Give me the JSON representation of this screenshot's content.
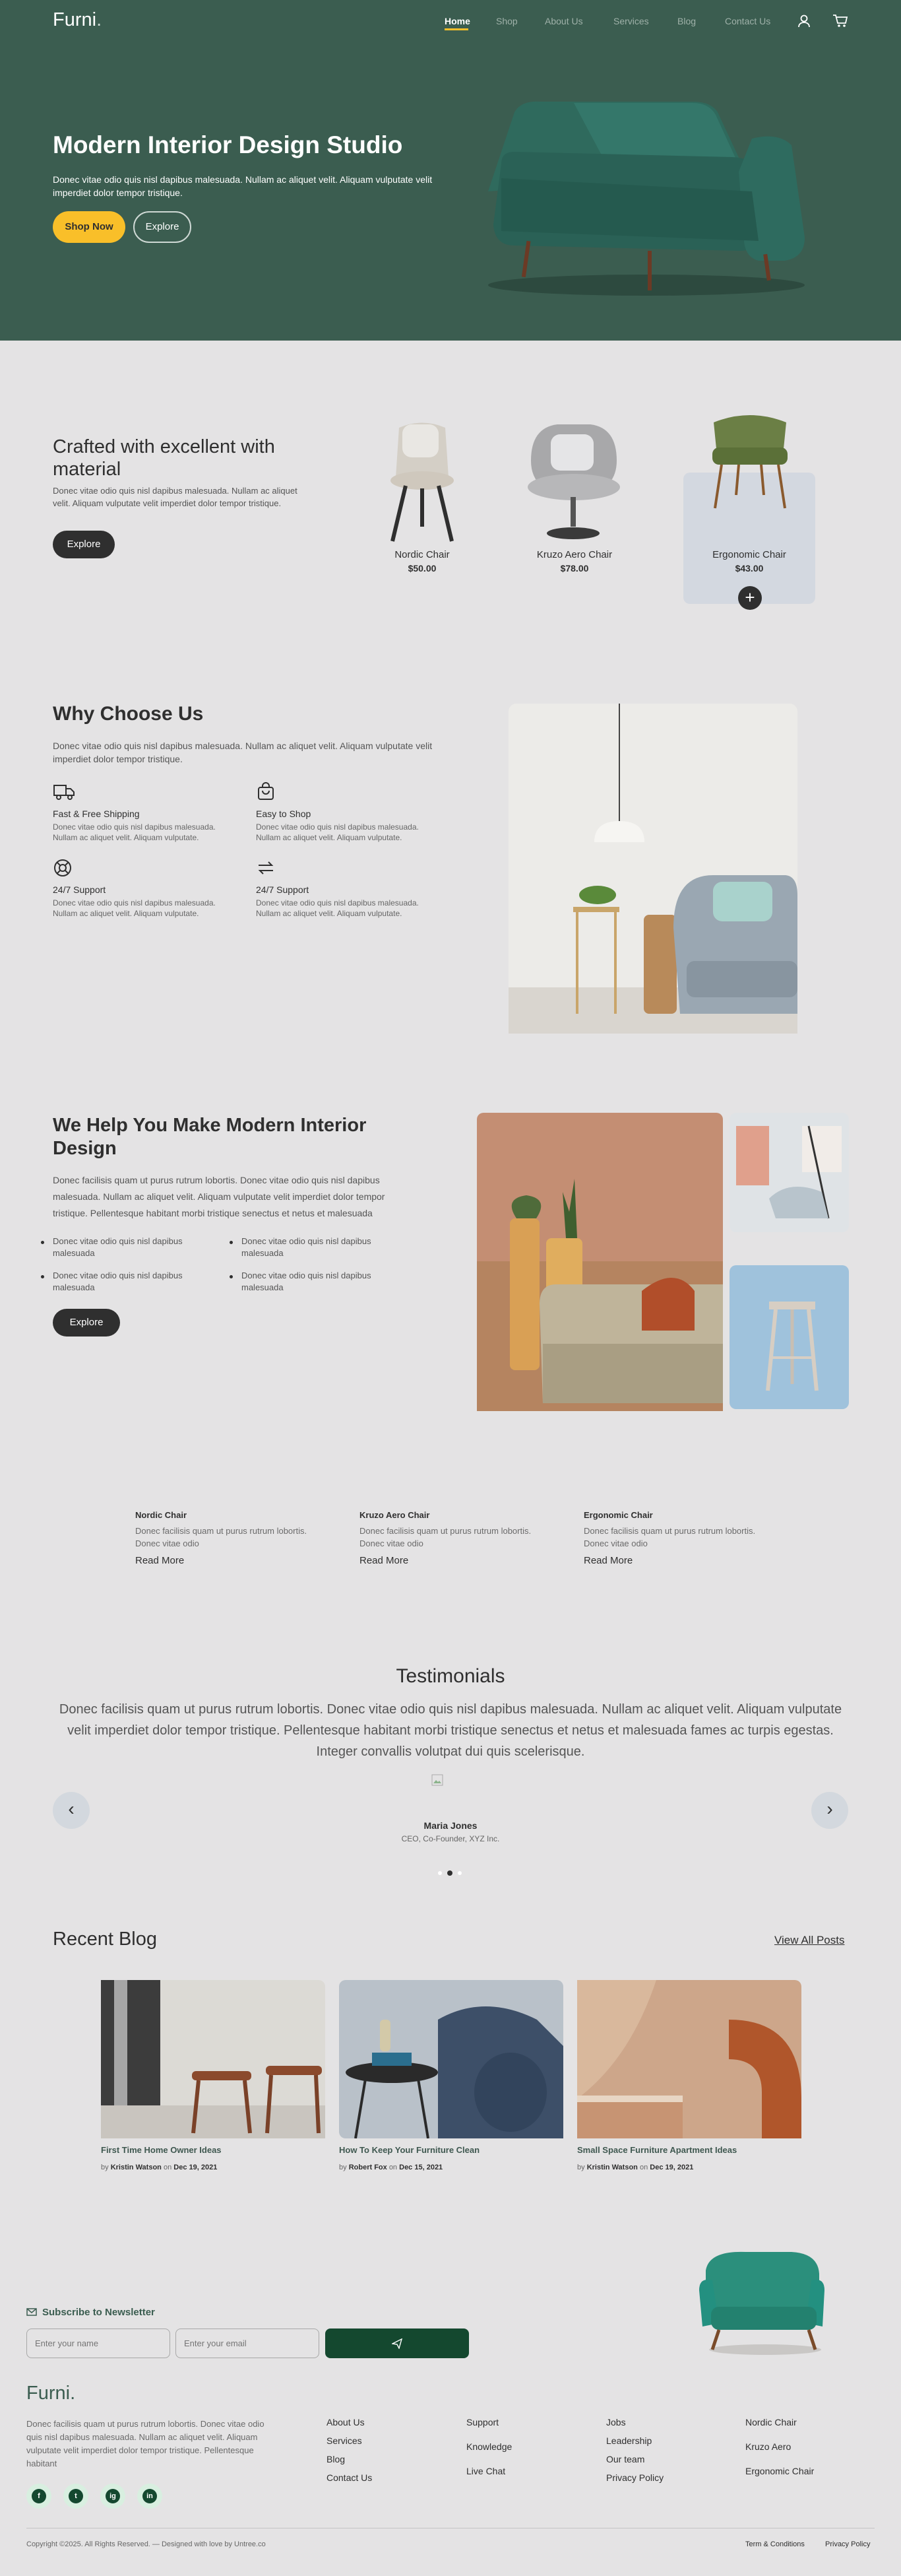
{
  "nav": {
    "logo": "Furni",
    "logo_dot": ".",
    "items": [
      "Home",
      "Shop",
      "About Us",
      "Services",
      "Blog",
      "Contact Us"
    ],
    "active": "Home",
    "icons": [
      "user-icon",
      "cart-icon"
    ]
  },
  "hero": {
    "title": "Modern Interior Design Studio",
    "text": "Donec vitae odio quis nisl dapibus malesuada. Nullam ac aliquet velit. Aliquam vulputate velit imperdiet dolor tempor tristique.",
    "shop_button": "Shop Now",
    "explore_button": "Explore"
  },
  "products": {
    "title": "Crafted with excellent with material",
    "text": "Donec vitae odio quis nisl dapibus malesuada. Nullam ac aliquet velit. Aliquam vulputate velit imperdiet dolor tempor tristique.",
    "button": "Explore",
    "items": [
      {
        "name": "Nordic Chair",
        "price": "$50.00"
      },
      {
        "name": "Kruzo Aero Chair",
        "price": "$78.00"
      },
      {
        "name": "Ergonomic Chair",
        "price": "$43.00"
      }
    ],
    "add_icon": "+"
  },
  "why": {
    "title": "Why Choose Us",
    "text": "Donec vitae odio quis nisl dapibus malesuada. Nullam ac aliquet velit. Aliquam vulputate velit imperdiet dolor tempor tristique.",
    "features": [
      {
        "icon": "truck-icon",
        "title": "Fast & Free Shipping",
        "text": "Donec vitae odio quis nisl dapibus malesuada. Nullam ac aliquet velit. Aliquam vulputate."
      },
      {
        "icon": "bag-icon",
        "title": "Easy to Shop",
        "text": "Donec vitae odio quis nisl dapibus malesuada. Nullam ac aliquet velit. Aliquam vulputate."
      },
      {
        "icon": "support-icon",
        "title": "24/7 Support",
        "text": "Donec vitae odio quis nisl dapibus malesuada. Nullam ac aliquet velit. Aliquam vulputate."
      },
      {
        "icon": "return-icon",
        "title": "24/7 Support",
        "text": "Donec vitae odio quis nisl dapibus malesuada. Nullam ac aliquet velit. Aliquam vulputate."
      }
    ]
  },
  "help": {
    "title": "We Help You Make Modern Interior Design",
    "text": "Donec facilisis quam ut purus rutrum lobortis. Donec vitae odio quis nisl dapibus malesuada. Nullam ac aliquet velit. Aliquam vulputate velit imperdiet dolor tempor tristique. Pellentesque habitant morbi tristique senectus et netus et malesuada",
    "bullets": [
      "Donec vitae odio quis nisl dapibus malesuada",
      "Donec vitae odio quis nisl dapibus malesuada",
      "Donec vitae odio quis nisl dapibus malesuada",
      "Donec vitae odio quis nisl dapibus malesuada"
    ],
    "button": "Explore"
  },
  "popular": [
    {
      "title": "Nordic Chair",
      "text": "Donec facilisis quam ut purus rutrum lobortis. Donec vitae odio",
      "link": "Read More"
    },
    {
      "title": "Kruzo Aero Chair",
      "text": "Donec facilisis quam ut purus rutrum lobortis. Donec vitae odio",
      "link": "Read More"
    },
    {
      "title": "Ergonomic Chair",
      "text": "Donec facilisis quam ut purus rutrum lobortis. Donec vitae odio",
      "link": "Read More"
    }
  ],
  "testimonials": {
    "title": "Testimonials",
    "quote": "Donec facilisis quam ut purus rutrum lobortis. Donec vitae odio quis nisl dapibus malesuada. Nullam ac aliquet velit. Aliquam vulputate velit imperdiet dolor tempor tristique. Pellentesque habitant morbi tristique senectus et netus et malesuada fames ac turpis egestas. Integer convallis volutpat dui quis scelerisque.",
    "name": "Maria Jones",
    "role": "CEO, Co-Founder, XYZ Inc.",
    "prev_icon": "‹",
    "next_icon": "›"
  },
  "blog": {
    "title": "Recent Blog",
    "view_all": "View All Posts",
    "by": "by",
    "on": "on",
    "posts": [
      {
        "title": "First Time Home Owner Ideas",
        "author": "Kristin Watson",
        "date": "Dec 19, 2021"
      },
      {
        "title": "How To Keep Your Furniture Clean",
        "author": "Robert Fox",
        "date": "Dec 15, 2021"
      },
      {
        "title": "Small Space Furniture Apartment Ideas",
        "author": "Kristin Watson",
        "date": "Dec 19, 2021"
      }
    ]
  },
  "newsletter": {
    "title": "Subscribe to Newsletter",
    "name_placeholder": "Enter your name",
    "email_placeholder": "Enter your email"
  },
  "footer": {
    "logo": "Furni",
    "logo_dot": ".",
    "text": "Donec facilisis quam ut purus rutrum lobortis. Donec vitae odio quis nisl dapibus malesuada. Nullam ac aliquet velit. Aliquam vulputate velit imperdiet dolor tempor tristique. Pellentesque habitant",
    "socials": [
      "f",
      "t",
      "ig",
      "in"
    ],
    "col1": [
      "About Us",
      "Services",
      "Blog",
      "Contact Us"
    ],
    "col2": [
      "Support",
      "Knowledge",
      "Live Chat"
    ],
    "col3": [
      "Jobs",
      "Leadership",
      "Our team",
      "Privacy Policy"
    ],
    "col4": [
      "Nordic Chair",
      "Kruzo Aero",
      "Ergonomic Chair"
    ],
    "copyright": "Copyright ©2025. All Rights Reserved. — Designed with love by Untree.co",
    "terms": "Term & Conditions",
    "privacy": "Privacy Policy"
  },
  "colors": {
    "brand_green": "#3b5d50",
    "accent_yellow": "#f9bf29",
    "dark": "#2f2f2f",
    "page_bg": "#e4e3e4"
  }
}
